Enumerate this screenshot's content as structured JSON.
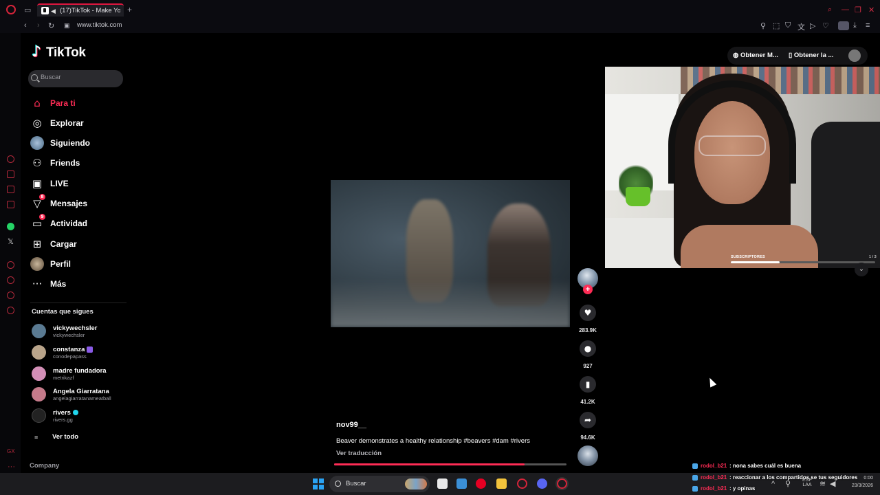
{
  "browser": {
    "tab_title": "(17)TikTok - Make Your",
    "url": "www.tiktok.com"
  },
  "tiktok": {
    "logo_text": "TikTok",
    "search_placeholder": "Buscar",
    "nav": [
      {
        "label": "Para ti",
        "icon": "home-icon",
        "active": true
      },
      {
        "label": "Explorar",
        "icon": "compass-icon"
      },
      {
        "label": "Siguiendo",
        "icon": "avatar-icon"
      },
      {
        "label": "Friends",
        "icon": "friends-icon"
      },
      {
        "label": "LIVE",
        "icon": "live-tv-icon"
      },
      {
        "label": "Mensajes",
        "icon": "send-icon",
        "badge": "8"
      },
      {
        "label": "Actividad",
        "icon": "activity-icon",
        "badge": "9"
      },
      {
        "label": "Cargar",
        "icon": "upload-icon"
      },
      {
        "label": "Perfil",
        "icon": "profile-avatar-icon"
      },
      {
        "label": "Más",
        "icon": "more-dots-icon"
      }
    ],
    "following_title": "Cuentas que sigues",
    "accounts": [
      {
        "name": "vickywechsler",
        "handle": "vickywechsler",
        "color": "#5a7a92"
      },
      {
        "name": "constanza",
        "handle": "conodepapass",
        "color": "#b9a48a",
        "badge": "c"
      },
      {
        "name": "madre fundadora",
        "handle": "metrikazf",
        "color": "#d38fb7"
      },
      {
        "name": "Angela Giarratana",
        "handle": "angelagiarratanameatball",
        "color": "#c57a8a"
      },
      {
        "name": "rivers",
        "handle": "rivers.gg",
        "color": "#222222",
        "verified": true
      }
    ],
    "see_all": "Ver todo",
    "company": "Company",
    "top_actions": {
      "get_coins": "Obtener M...",
      "get_app": "Obtener la ..."
    }
  },
  "video": {
    "author": "nov99__",
    "caption": "Beaver demonstrates a healthy relationship #beavers #dam #rivers",
    "translate": "Ver traducción",
    "progress": 0.82,
    "likes": "283.9K",
    "comments": "927",
    "saves": "41.2K",
    "shares": "94.6K"
  },
  "webcam": {
    "sub_label": "SUBSCRIPTORES",
    "sub_count": "1 / 3",
    "sub_progress": 0.34
  },
  "chat": [
    {
      "user": "rodol_b21",
      "message": ": nona sabes cuál es buena"
    },
    {
      "user": "rodol_b21",
      "message": ": reaccionar a los compartidos se tus seguidores"
    },
    {
      "user": "rodol_b21",
      "message": ": y opinas"
    }
  ],
  "taskbar": {
    "search_label": "Buscar",
    "lang": "ESP\nLAA",
    "time": "0:00",
    "date": "23/3/2026"
  },
  "colors": {
    "accent": "#fe2c55",
    "opera": "#d6243a"
  }
}
